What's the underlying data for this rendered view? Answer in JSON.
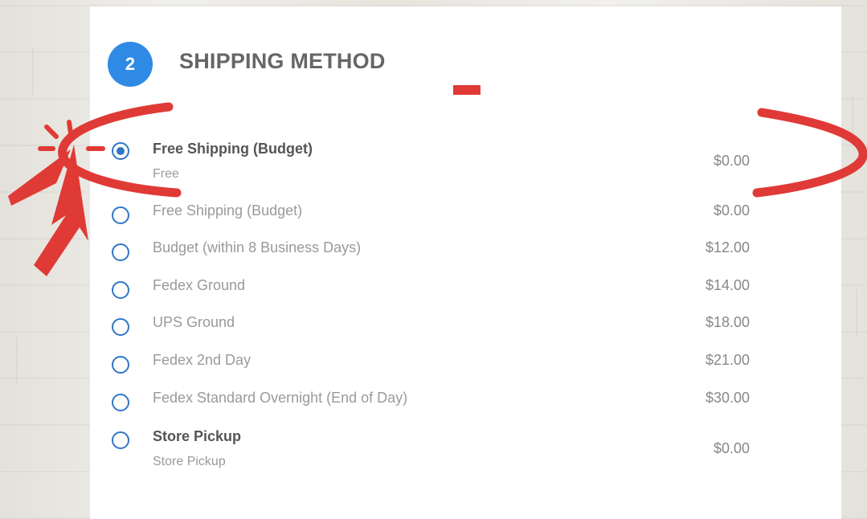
{
  "section": {
    "step_number": "2",
    "title": "SHIPPING METHOD"
  },
  "options": [
    {
      "name": "Free Shipping (Budget)",
      "sub": "Free",
      "price": "$0.00",
      "selected": true
    },
    {
      "name": "Free Shipping (Budget)",
      "price": "$0.00",
      "selected": false
    },
    {
      "name": "Budget (within 8 Business Days)",
      "price": "$12.00",
      "selected": false
    },
    {
      "name": "Fedex Ground",
      "price": "$14.00",
      "selected": false
    },
    {
      "name": "UPS Ground",
      "price": "$18.00",
      "selected": false
    },
    {
      "name": "Fedex 2nd Day",
      "price": "$21.00",
      "selected": false
    },
    {
      "name": "Fedex Standard Overnight (End of Day)",
      "price": "$30.00",
      "selected": false
    },
    {
      "name": "Store Pickup",
      "sub": "Store Pickup",
      "price": "$0.00",
      "selected": false
    }
  ],
  "colors": {
    "accent": "#2f8ae5",
    "radio": "#2f76c6",
    "annotation": "#e03a36"
  },
  "annotations": {
    "pointer": "arrow-cursor-icon",
    "highlight": "circle-highlight"
  }
}
